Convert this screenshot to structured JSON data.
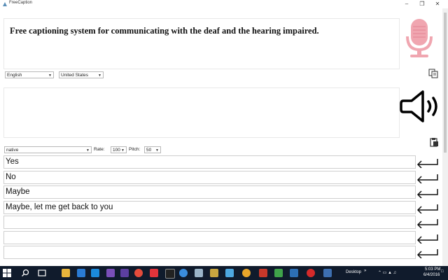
{
  "window": {
    "title": "FreeCaption"
  },
  "caption": {
    "text": "Free captioning system for communicating with the deaf and the hearing impaired."
  },
  "language": {
    "selected": "English"
  },
  "region": {
    "selected": "United States"
  },
  "speech_input": {
    "value": ""
  },
  "voice": {
    "selected": "native",
    "rate_label": "Rate:",
    "rate_value": "100",
    "pitch_label": "Pitch:",
    "pitch_value": "50"
  },
  "phrases": [
    "Yes",
    "No",
    "Maybe",
    "Maybe, let me get back to you",
    "",
    "",
    ""
  ],
  "taskbar": {
    "desktop_label": "Desktop",
    "time": "5:03 PM",
    "date": "6/4/2016"
  },
  "colors": {
    "mic": "#f0a6b0",
    "taskbar": "#101b2c"
  },
  "icons": [
    "app-icon",
    "microphone-icon",
    "copy-icon",
    "speaker-icon",
    "enter-arrow-icon",
    "windows-start-icon",
    "search-icon",
    "task-view-icon"
  ]
}
